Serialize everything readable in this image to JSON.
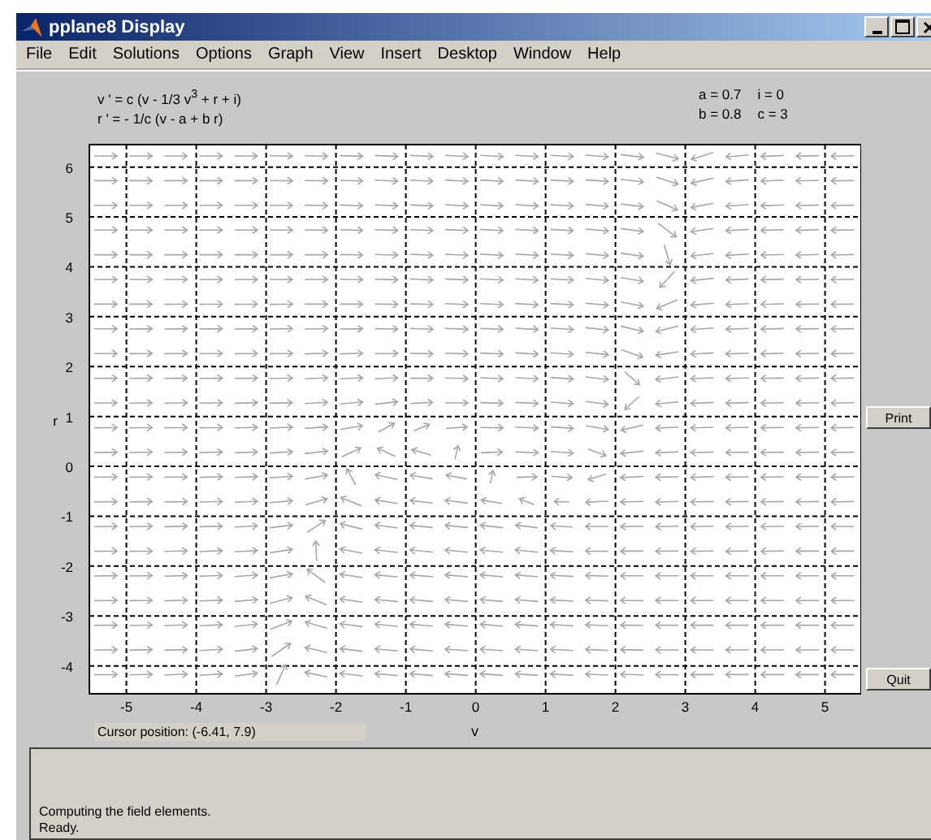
{
  "window": {
    "title": "pplane8 Display"
  },
  "menu": [
    "File",
    "Edit",
    "Solutions",
    "Options",
    "Graph",
    "View",
    "Insert",
    "Desktop",
    "Window",
    "Help"
  ],
  "equations": [
    "v ' = c (v - 1/3 v$^{3}$ + r + i)",
    "r ' = - 1/c (v - a + b r)"
  ],
  "parameters": [
    [
      "a = 0.7",
      "i = 0"
    ],
    [
      "b = 0.8",
      "c = 3"
    ]
  ],
  "plot": {
    "xticks": [
      "-5",
      "-4",
      "-3",
      "-2",
      "-1",
      "0",
      "1",
      "2",
      "3",
      "4",
      "5"
    ],
    "yticks": [
      "6",
      "5",
      "4",
      "3",
      "2",
      "1",
      "0",
      "-1",
      "-2",
      "-3",
      "-4"
    ],
    "xlabel": "v",
    "ylabel": "r"
  },
  "buttons": [
    "Print",
    "Quit"
  ],
  "cursor_position": "Cursor position:   (-6.41, 7.9)",
  "messages": [
    "Computing the field elements.",
    "Ready."
  ]
}
